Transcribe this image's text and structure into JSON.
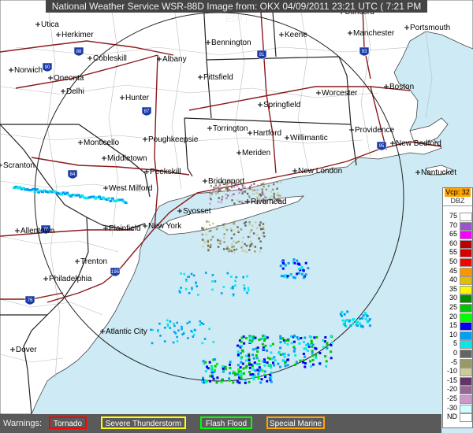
{
  "header": {
    "title": "National Weather Service WSR-88D Image from: OKX 04/09/2011  23:21 UTC  ( 7:21 PM EDT)"
  },
  "cities": [
    {
      "name": "Concord"
    },
    {
      "name": "Utica"
    },
    {
      "name": "Herkimer"
    },
    {
      "name": "Bennington"
    },
    {
      "name": "Keene"
    },
    {
      "name": "Manchester"
    },
    {
      "name": "Portsmouth"
    },
    {
      "name": "Cobleskill"
    },
    {
      "name": "Albany"
    },
    {
      "name": "Norwich"
    },
    {
      "name": "Oneonta"
    },
    {
      "name": "Delhi"
    },
    {
      "name": "Pittsfield"
    },
    {
      "name": "Hunter"
    },
    {
      "name": "Worcester"
    },
    {
      "name": "Boston"
    },
    {
      "name": "Springfield"
    },
    {
      "name": "Torrington"
    },
    {
      "name": "Hartford"
    },
    {
      "name": "Willimantic"
    },
    {
      "name": "Providence"
    },
    {
      "name": "New Bedford"
    },
    {
      "name": "Monticello"
    },
    {
      "name": "Poughkeepsie"
    },
    {
      "name": "Middletown"
    },
    {
      "name": "Meriden"
    },
    {
      "name": "Scranton"
    },
    {
      "name": "Peekskill"
    },
    {
      "name": "New London"
    },
    {
      "name": "Nantucket"
    },
    {
      "name": "Bridgeport"
    },
    {
      "name": "West Milford"
    },
    {
      "name": "Riverhead"
    },
    {
      "name": "Syosset"
    },
    {
      "name": "Allentown"
    },
    {
      "name": "Plainfield"
    },
    {
      "name": "New York"
    },
    {
      "name": "Trenton"
    },
    {
      "name": "Philadelphia"
    },
    {
      "name": "Atlantic City"
    },
    {
      "name": "Dover"
    }
  ],
  "highways": [
    "88",
    "90",
    "91",
    "93",
    "87",
    "84",
    "95",
    "195",
    "78",
    "76"
  ],
  "legend": {
    "vcp": "Vcp: 32",
    "unit": "DBZ",
    "rows": [
      {
        "label": "75",
        "color": "#ffffff"
      },
      {
        "label": "70",
        "color": "#9955c9"
      },
      {
        "label": "65",
        "color": "#f800fd"
      },
      {
        "label": "60",
        "color": "#bc0000"
      },
      {
        "label": "55",
        "color": "#d40000"
      },
      {
        "label": "50",
        "color": "#fd0000"
      },
      {
        "label": "45",
        "color": "#fd9500"
      },
      {
        "label": "40",
        "color": "#e5bc00"
      },
      {
        "label": "35",
        "color": "#fdf802"
      },
      {
        "label": "30",
        "color": "#008e00"
      },
      {
        "label": "25",
        "color": "#01c501"
      },
      {
        "label": "20",
        "color": "#02fd02"
      },
      {
        "label": "15",
        "color": "#0300f4"
      },
      {
        "label": "10",
        "color": "#019ff4"
      },
      {
        "label": "5",
        "color": "#04e9e7"
      },
      {
        "label": "0",
        "color": "#646464"
      },
      {
        "label": "-5",
        "color": "#999966"
      },
      {
        "label": "-10",
        "color": "#cccc99"
      },
      {
        "label": "-15",
        "color": "#663366"
      },
      {
        "label": "-20",
        "color": "#996699"
      },
      {
        "label": "-25",
        "color": "#cc99cc"
      },
      {
        "label": "-30",
        "color": "#ccffff"
      },
      {
        "label": "ND",
        "color": "#ffffff"
      }
    ]
  },
  "warnings": {
    "label": "Warnings:",
    "items": [
      {
        "label": "Tornado",
        "color": "#ff0000"
      },
      {
        "label": "Severe Thunderstorm",
        "color": "#ffff00"
      },
      {
        "label": "Flash Flood",
        "color": "#00ff00"
      },
      {
        "label": "Special Marine",
        "color": "#ffa500"
      }
    ]
  },
  "colors": {
    "ocean": "#cdeaf5",
    "land": "#ffffff",
    "state_border": "#222222",
    "county_border": "#bbbbbb",
    "highway": "#8b1a1a",
    "range_ring": "#222222"
  }
}
